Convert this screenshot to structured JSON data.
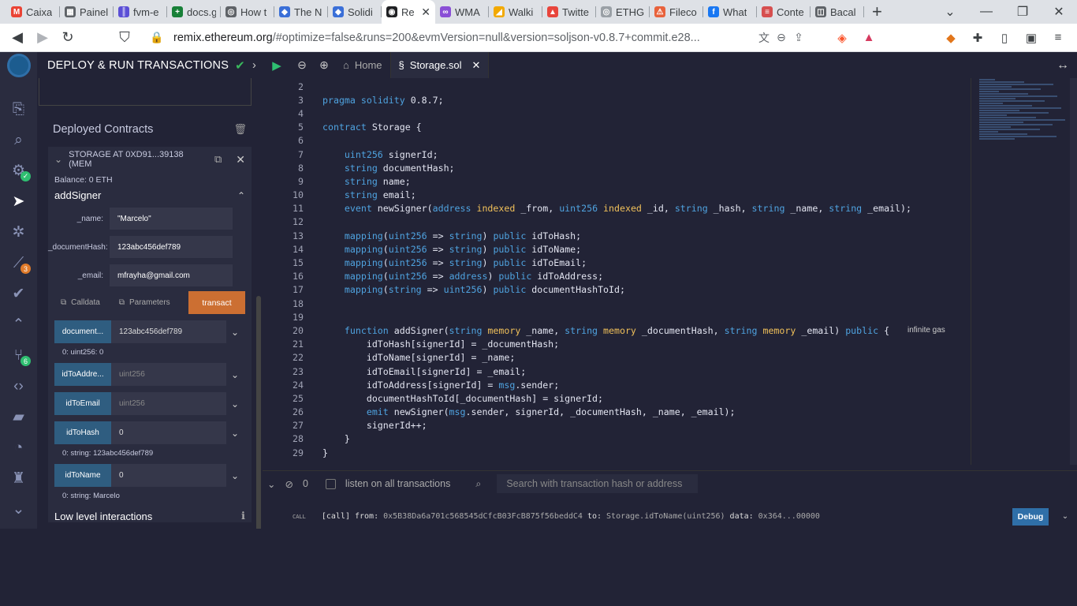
{
  "browser": {
    "tabs": [
      {
        "label": "Caixa",
        "color": "#ea4335",
        "glyph": "M"
      },
      {
        "label": "Painel",
        "color": "#5f6368",
        "glyph": "▦"
      },
      {
        "label": "fvm-e",
        "color": "#5b4fd6",
        "glyph": "║"
      },
      {
        "label": "docs.g",
        "color": "#188038",
        "glyph": "+"
      },
      {
        "label": "How t",
        "color": "#5f6368",
        "glyph": "◎"
      },
      {
        "label": "The N",
        "color": "#3a6fd8",
        "glyph": "◆"
      },
      {
        "label": "Solidi",
        "color": "#3a6fd8",
        "glyph": "◆"
      },
      {
        "label": "Re",
        "color": "#202124",
        "glyph": "◉"
      },
      {
        "label": "WMA",
        "color": "#8a4fd6",
        "glyph": "∞"
      },
      {
        "label": "Walki",
        "color": "#f2a900",
        "glyph": "◢"
      },
      {
        "label": "Twitte",
        "color": "#e8453c",
        "glyph": "▲"
      },
      {
        "label": "ETHGl",
        "color": "#9aa0a6",
        "glyph": "◎"
      },
      {
        "label": "Fileco",
        "color": "#e8623c",
        "glyph": "⚠"
      },
      {
        "label": "What",
        "color": "#1877f2",
        "glyph": "f"
      },
      {
        "label": "Conte",
        "color": "#d64f4f",
        "glyph": "≡"
      },
      {
        "label": "Bacal",
        "color": "#5f6368",
        "glyph": "◫"
      }
    ],
    "active_tab_index": 7,
    "url_host": "remix.ethereum.org",
    "url_path": "/#optimize=false&runs=200&evmVersion=null&version=soljson-v0.8.7+commit.e28..."
  },
  "remix": {
    "panel_title": "DEPLOY & RUN TRANSACTIONS",
    "editor_tabs": [
      {
        "label": "Home"
      },
      {
        "label": "Storage.sol"
      }
    ],
    "badges": {
      "analysis": "3",
      "git": "6"
    },
    "deployed": {
      "heading": "Deployed Contracts",
      "instance": "STORAGE AT 0XD91...39138 (MEM",
      "balance": "Balance: 0 ETH",
      "fn_name": "addSigner",
      "params": [
        {
          "label": "_name:",
          "value": "\"Marcelo\""
        },
        {
          "label": "_documentHash:",
          "value": "123abc456def789"
        },
        {
          "label": "_email:",
          "value": "mfrayha@gmail.com"
        }
      ],
      "calldata": "Calldata",
      "parameters": "Parameters",
      "transact": "transact",
      "getters": [
        {
          "name": "document...",
          "value": "123abc456def789",
          "placeholder": false,
          "output": "0: uint256: 0"
        },
        {
          "name": "idToAddre...",
          "value": "uint256",
          "placeholder": true,
          "output": ""
        },
        {
          "name": "idToEmail",
          "value": "uint256",
          "placeholder": true,
          "output": ""
        },
        {
          "name": "idToHash",
          "value": "0",
          "placeholder": false,
          "output": "0: string: 123abc456def789"
        },
        {
          "name": "idToName",
          "value": "0",
          "placeholder": false,
          "output": "0: string: Marcelo"
        }
      ],
      "low_level": "Low level interactions"
    },
    "terminal": {
      "count": "0",
      "listen_label": "listen on all transactions",
      "search_placeholder": "Search with transaction hash or address",
      "log_tag": "CALL",
      "log_call": "[call]",
      "log_from_label": "from:",
      "log_from": "0x5B38Da6a701c568545dCfcB03FcB875f56beddC4",
      "log_to_label": "to:",
      "log_to": "Storage.idToName(uint256)",
      "log_data_label": "data:",
      "log_data": "0x364...00000",
      "debug": "Debug"
    },
    "infinite_gas": "infinite gas"
  },
  "code_lines": [
    {
      "n": "2",
      "html": ""
    },
    {
      "n": "3",
      "html": "<span class='kw'>pragma</span> <span class='kw'>solidity</span> 0.8.7;"
    },
    {
      "n": "4",
      "html": ""
    },
    {
      "n": "5",
      "html": "<span class='kw'>contract</span> Storage {"
    },
    {
      "n": "6",
      "html": ""
    },
    {
      "n": "7",
      "html": "    <span class='ty'>uint256</span> signerId;"
    },
    {
      "n": "8",
      "html": "    <span class='ty'>string</span> documentHash;"
    },
    {
      "n": "9",
      "html": "    <span class='ty'>string</span> name;"
    },
    {
      "n": "10",
      "html": "    <span class='ty'>string</span> email;"
    },
    {
      "n": "11",
      "html": "    <span class='kw'>event</span> newSigner(<span class='ty'>address</span> <span class='mod'>indexed</span> _from, <span class='ty'>uint256</span> <span class='mod'>indexed</span> _id, <span class='ty'>string</span> _hash, <span class='ty'>string</span> _name, <span class='ty'>string</span> _email);"
    },
    {
      "n": "12",
      "html": ""
    },
    {
      "n": "13",
      "html": "    <span class='kw'>mapping</span>(<span class='ty'>uint256</span> => <span class='ty'>string</span>) <span class='kw'>public</span> idToHash;"
    },
    {
      "n": "14",
      "html": "    <span class='kw'>mapping</span>(<span class='ty'>uint256</span> => <span class='ty'>string</span>) <span class='kw'>public</span> idToName;"
    },
    {
      "n": "15",
      "html": "    <span class='kw'>mapping</span>(<span class='ty'>uint256</span> => <span class='ty'>string</span>) <span class='kw'>public</span> idToEmail;"
    },
    {
      "n": "16",
      "html": "    <span class='kw'>mapping</span>(<span class='ty'>uint256</span> => <span class='ty'>address</span>) <span class='kw'>public</span> idToAddress;"
    },
    {
      "n": "17",
      "html": "    <span class='kw'>mapping</span>(<span class='ty'>string</span> => <span class='ty'>uint256</span>) <span class='kw'>public</span> documentHashToId;"
    },
    {
      "n": "18",
      "html": ""
    },
    {
      "n": "19",
      "html": ""
    },
    {
      "n": "20",
      "html": "    <span class='kw'>function</span> addSigner(<span class='ty'>string</span> <span class='mod'>memory</span> _name, <span class='ty'>string</span> <span class='mod'>memory</span> _documentHash, <span class='ty'>string</span> <span class='mod'>memory</span> _email) <span class='kw'>public</span> {"
    },
    {
      "n": "21",
      "html": "        idToHash[signerId] = _documentHash;"
    },
    {
      "n": "22",
      "html": "        idToName[signerId] = _name;"
    },
    {
      "n": "23",
      "html": "        idToEmail[signerId] = _email;"
    },
    {
      "n": "24",
      "html": "        idToAddress[signerId] = <span class='kw'>msg</span>.sender;"
    },
    {
      "n": "25",
      "html": "        documentHashToId[_documentHash] = signerId;"
    },
    {
      "n": "26",
      "html": "        <span class='kw'>emit</span> newSigner(<span class='kw'>msg</span>.sender, signerId, _documentHash, _name, _email);"
    },
    {
      "n": "27",
      "html": "        signerId++;"
    },
    {
      "n": "28",
      "html": "    }"
    },
    {
      "n": "29",
      "html": "}"
    }
  ]
}
